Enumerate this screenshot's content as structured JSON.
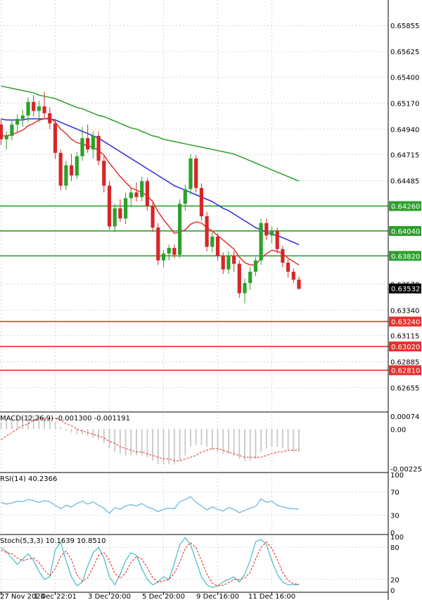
{
  "colors": {
    "bull": "#2ca02c",
    "bear": "#d62728",
    "ma_fast": "#e8302c",
    "ma_mid": "#2b2bdc",
    "ma_slow": "#2ca02c",
    "support": "#e8302c",
    "resistance": "#2ca02c",
    "grid": "#cfcfcf",
    "macd_hist": "#c8c8c8",
    "macd_signal": "#e8302c",
    "rsi": "#6cb6e6",
    "stoch_main": "#50c0c8",
    "stoch_signal": "#e8302c"
  },
  "chart_data": [
    {
      "type": "candlestick",
      "panel": "price",
      "y_ticks": [
        0.65855,
        0.65625,
        0.654,
        0.6517,
        0.6494,
        0.64715,
        0.64485,
        0.6426,
        0.6404,
        0.6382,
        0.6357,
        0.6334,
        0.63115,
        0.62885,
        0.62655
      ],
      "y_tick_labels": [
        "0.65855",
        "0.65625",
        "0.65400",
        "0.65170",
        "0.64940",
        "0.64715",
        "0.64485",
        "",
        "",
        "",
        "0.63570",
        "0.63340",
        "0.63115",
        "0.62885",
        "0.62655"
      ],
      "ylim": [
        0.6246,
        0.6608
      ],
      "current_price": 0.63532,
      "current_price_label": "0.63532",
      "resistance_levels": [
        {
          "value": 0.6426,
          "label": "0.64260"
        },
        {
          "value": 0.6404,
          "label": "0.64040"
        },
        {
          "value": 0.6382,
          "label": "0.63820"
        }
      ],
      "support_levels": [
        {
          "value": 0.6324,
          "label": "0.63240"
        },
        {
          "value": 0.6302,
          "label": "0.63020"
        },
        {
          "value": 0.6281,
          "label": "0.62810"
        }
      ],
      "x_tick_labels": [
        "27 Nov 2024",
        "1 Dec 22:01",
        "3 Dec 20:00",
        "5 Dec 20:00",
        "9 Dec 16:00",
        "11 Dec 16:00"
      ],
      "x_tick_index": [
        0,
        10,
        20,
        30,
        40,
        50
      ],
      "ohlc": [
        [
          0.6498,
          0.6503,
          0.648,
          0.6485
        ],
        [
          0.6485,
          0.6492,
          0.6476,
          0.6488
        ],
        [
          0.6488,
          0.6502,
          0.6484,
          0.6498
        ],
        [
          0.6498,
          0.6507,
          0.6491,
          0.6503
        ],
        [
          0.6503,
          0.6511,
          0.6496,
          0.6506
        ],
        [
          0.6506,
          0.6522,
          0.65,
          0.6518
        ],
        [
          0.6518,
          0.6524,
          0.6505,
          0.651
        ],
        [
          0.651,
          0.6519,
          0.65,
          0.6514
        ],
        [
          0.6514,
          0.6527,
          0.6503,
          0.6508
        ],
        [
          0.6508,
          0.6513,
          0.6494,
          0.6499
        ],
        [
          0.6499,
          0.6503,
          0.6468,
          0.6473
        ],
        [
          0.6473,
          0.6476,
          0.644,
          0.6444
        ],
        [
          0.6444,
          0.6466,
          0.644,
          0.6462
        ],
        [
          0.6462,
          0.6472,
          0.6448,
          0.6453
        ],
        [
          0.6453,
          0.6474,
          0.645,
          0.647
        ],
        [
          0.647,
          0.6496,
          0.6466,
          0.6486
        ],
        [
          0.6486,
          0.6498,
          0.6473,
          0.6476
        ],
        [
          0.6476,
          0.6492,
          0.6468,
          0.6488
        ],
        [
          0.6488,
          0.6492,
          0.6462,
          0.6466
        ],
        [
          0.6466,
          0.647,
          0.6438,
          0.6444
        ],
        [
          0.6444,
          0.6448,
          0.6405,
          0.6408
        ],
        [
          0.6408,
          0.6428,
          0.6403,
          0.6424
        ],
        [
          0.6424,
          0.6432,
          0.6412,
          0.6415
        ],
        [
          0.6415,
          0.6438,
          0.641,
          0.6433
        ],
        [
          0.6433,
          0.6442,
          0.6425,
          0.6438
        ],
        [
          0.6438,
          0.6447,
          0.643,
          0.6434
        ],
        [
          0.6434,
          0.6452,
          0.643,
          0.6448
        ],
        [
          0.6448,
          0.6451,
          0.6422,
          0.6426
        ],
        [
          0.6426,
          0.6429,
          0.6403,
          0.6407
        ],
        [
          0.6407,
          0.6411,
          0.6374,
          0.6378
        ],
        [
          0.6378,
          0.6387,
          0.6372,
          0.6384
        ],
        [
          0.6384,
          0.6392,
          0.6378,
          0.6389
        ],
        [
          0.6389,
          0.6392,
          0.638,
          0.6383
        ],
        [
          0.6383,
          0.6432,
          0.638,
          0.6428
        ],
        [
          0.6428,
          0.6445,
          0.6422,
          0.6441
        ],
        [
          0.6441,
          0.6472,
          0.6436,
          0.6468
        ],
        [
          0.6468,
          0.6471,
          0.6438,
          0.6442
        ],
        [
          0.6442,
          0.6446,
          0.6413,
          0.6417
        ],
        [
          0.6417,
          0.6421,
          0.6386,
          0.639
        ],
        [
          0.639,
          0.6403,
          0.6385,
          0.6399
        ],
        [
          0.6399,
          0.6402,
          0.6378,
          0.6382
        ],
        [
          0.6382,
          0.6385,
          0.6366,
          0.637
        ],
        [
          0.637,
          0.6386,
          0.6366,
          0.6382
        ],
        [
          0.6382,
          0.6386,
          0.6368,
          0.6375
        ],
        [
          0.6375,
          0.6378,
          0.6345,
          0.6349
        ],
        [
          0.6349,
          0.6362,
          0.634,
          0.6358
        ],
        [
          0.6358,
          0.6372,
          0.6352,
          0.6368
        ],
        [
          0.6368,
          0.6381,
          0.6364,
          0.6378
        ],
        [
          0.6378,
          0.6415,
          0.6374,
          0.6411
        ],
        [
          0.6411,
          0.6415,
          0.6396,
          0.64
        ],
        [
          0.64,
          0.6408,
          0.6393,
          0.6404
        ],
        [
          0.6404,
          0.6407,
          0.6384,
          0.6388
        ],
        [
          0.6388,
          0.6391,
          0.6372,
          0.6376
        ],
        [
          0.6376,
          0.6379,
          0.6363,
          0.6368
        ],
        [
          0.6368,
          0.6371,
          0.6358,
          0.6361
        ],
        [
          0.6361,
          0.6364,
          0.6352,
          0.6353
        ]
      ],
      "ma_fast": [
        0.6488,
        0.6488,
        0.6489,
        0.6491,
        0.6493,
        0.6497,
        0.6499,
        0.6502,
        0.6503,
        0.6504,
        0.65,
        0.6494,
        0.649,
        0.6485,
        0.6482,
        0.6481,
        0.6479,
        0.6478,
        0.6475,
        0.6471,
        0.6464,
        0.6458,
        0.6452,
        0.6447,
        0.6442,
        0.644,
        0.6438,
        0.6435,
        0.643,
        0.6421,
        0.6414,
        0.6408,
        0.6402,
        0.6403,
        0.6405,
        0.641,
        0.6412,
        0.6411,
        0.6407,
        0.6404,
        0.64,
        0.6396,
        0.6392,
        0.6388,
        0.6381,
        0.6376,
        0.6374,
        0.6374,
        0.638,
        0.6384,
        0.6387,
        0.6386,
        0.6384,
        0.638,
        0.6377,
        0.6374
      ],
      "ma_mid": [
        0.6503,
        0.6502,
        0.6502,
        0.6502,
        0.6502,
        0.6503,
        0.6503,
        0.6503,
        0.6503,
        0.6503,
        0.6502,
        0.65,
        0.6498,
        0.6496,
        0.6494,
        0.6492,
        0.649,
        0.6488,
        0.6486,
        0.6483,
        0.648,
        0.6477,
        0.6474,
        0.6471,
        0.6468,
        0.6465,
        0.6462,
        0.6459,
        0.6456,
        0.6453,
        0.645,
        0.6447,
        0.6444,
        0.6442,
        0.644,
        0.6438,
        0.6436,
        0.6434,
        0.6432,
        0.643,
        0.6427,
        0.6424,
        0.6422,
        0.6419,
        0.6416,
        0.6413,
        0.641,
        0.6407,
        0.6405,
        0.6403,
        0.6401,
        0.64,
        0.6398,
        0.6396,
        0.6394,
        0.6392
      ],
      "ma_slow": [
        0.6532,
        0.6531,
        0.653,
        0.6529,
        0.6528,
        0.6527,
        0.6526,
        0.6524,
        0.6523,
        0.6522,
        0.6521,
        0.6519,
        0.6517,
        0.6515,
        0.6513,
        0.6512,
        0.651,
        0.6508,
        0.6506,
        0.6505,
        0.6503,
        0.6501,
        0.6499,
        0.6497,
        0.6495,
        0.6494,
        0.6492,
        0.649,
        0.6488,
        0.6487,
        0.6485,
        0.6484,
        0.6483,
        0.6482,
        0.6481,
        0.648,
        0.6479,
        0.6478,
        0.6477,
        0.6476,
        0.6475,
        0.6474,
        0.6473,
        0.6472,
        0.647,
        0.6468,
        0.6466,
        0.6464,
        0.6462,
        0.646,
        0.6458,
        0.6456,
        0.6454,
        0.6452,
        0.645,
        0.6448
      ]
    },
    {
      "type": "bar",
      "panel": "macd",
      "title": "MACD(12,26,9) -0.001300 -0.001191",
      "y_tick_labels": [
        "0.00074",
        "0.00",
        "-0.002252"
      ],
      "ylim": [
        -0.00235,
        0.00085
      ],
      "y_ticks": [
        0.00074,
        0.0,
        -0.002252
      ],
      "histogram": [
        0.0004,
        0.0005,
        0.0006,
        0.0007,
        0.0007,
        0.0008,
        0.0008,
        0.0008,
        0.0007,
        0.0006,
        0.0004,
        0.0001,
        -0.0001,
        -0.0002,
        -0.0003,
        -0.0003,
        -0.0004,
        -0.0005,
        -0.0006,
        -0.0008,
        -0.0011,
        -0.0013,
        -0.0014,
        -0.0015,
        -0.0015,
        -0.0015,
        -0.0015,
        -0.0016,
        -0.0018,
        -0.002,
        -0.002,
        -0.002,
        -0.002,
        -0.0018,
        -0.0015,
        -0.001,
        -0.0009,
        -0.0009,
        -0.001,
        -0.0012,
        -0.0013,
        -0.0014,
        -0.0014,
        -0.0015,
        -0.0017,
        -0.0018,
        -0.0018,
        -0.0017,
        -0.0013,
        -0.0011,
        -0.001,
        -0.001,
        -0.0011,
        -0.0012,
        -0.0013,
        -0.0013
      ],
      "signal": [
        -0.0006,
        -0.0004,
        -0.0002,
        0.0,
        0.0002,
        0.0003,
        0.0005,
        0.0006,
        0.0006,
        0.0006,
        0.0006,
        0.0005,
        0.0003,
        0.0002,
        0.0,
        -0.0001,
        -0.0002,
        -0.0003,
        -0.0004,
        -0.0005,
        -0.0007,
        -0.0008,
        -0.001,
        -0.0011,
        -0.0012,
        -0.0013,
        -0.0013,
        -0.0014,
        -0.0015,
        -0.0016,
        -0.0017,
        -0.0017,
        -0.0018,
        -0.0018,
        -0.0017,
        -0.0016,
        -0.0015,
        -0.0013,
        -0.0012,
        -0.0011,
        -0.0011,
        -0.0012,
        -0.0013,
        -0.0014,
        -0.0015,
        -0.0016,
        -0.0016,
        -0.0016,
        -0.0016,
        -0.0015,
        -0.0014,
        -0.0013,
        -0.0013,
        -0.0012,
        -0.0012,
        -0.0012
      ]
    },
    {
      "type": "line",
      "panel": "rsi",
      "title": "RSI(14) 40.2366",
      "y_ticks": [
        100,
        70,
        30,
        0
      ],
      "y_tick_labels": [
        "100",
        "70",
        "30",
        "0"
      ],
      "ylim": [
        0,
        100
      ],
      "values": [
        52,
        49,
        51,
        54,
        53,
        57,
        55,
        52,
        55,
        53,
        47,
        41,
        47,
        44,
        50,
        54,
        49,
        53,
        47,
        42,
        33,
        43,
        40,
        46,
        48,
        46,
        50,
        44,
        41,
        36,
        40,
        42,
        41,
        53,
        57,
        62,
        52,
        46,
        39,
        44,
        40,
        37,
        43,
        40,
        34,
        38,
        42,
        45,
        58,
        52,
        54,
        47,
        44,
        42,
        41,
        40
      ]
    },
    {
      "type": "line",
      "panel": "stoch",
      "title": "Stoch(5,3,3) 10.1639 10.8510",
      "y_ticks": [
        100,
        80,
        20,
        0
      ],
      "y_tick_labels": [
        "100",
        "80",
        "20",
        "0"
      ],
      "ylim": [
        0,
        100
      ],
      "main": [
        80,
        72,
        60,
        48,
        58,
        68,
        55,
        35,
        20,
        25,
        75,
        90,
        55,
        25,
        8,
        15,
        45,
        70,
        80,
        60,
        25,
        10,
        30,
        55,
        70,
        65,
        40,
        20,
        10,
        15,
        25,
        20,
        50,
        85,
        98,
        85,
        55,
        25,
        10,
        5,
        8,
        15,
        20,
        25,
        15,
        30,
        55,
        90,
        95,
        85,
        55,
        30,
        15,
        10,
        10,
        10
      ],
      "signal": [
        75,
        70,
        68,
        60,
        55,
        58,
        60,
        52,
        37,
        27,
        40,
        63,
        73,
        57,
        29,
        16,
        23,
        43,
        65,
        70,
        55,
        32,
        22,
        32,
        52,
        63,
        58,
        42,
        23,
        15,
        17,
        20,
        32,
        52,
        78,
        89,
        79,
        55,
        30,
        13,
        8,
        9,
        14,
        20,
        20,
        23,
        33,
        58,
        80,
        90,
        78,
        57,
        33,
        18,
        12,
        11
      ]
    }
  ]
}
